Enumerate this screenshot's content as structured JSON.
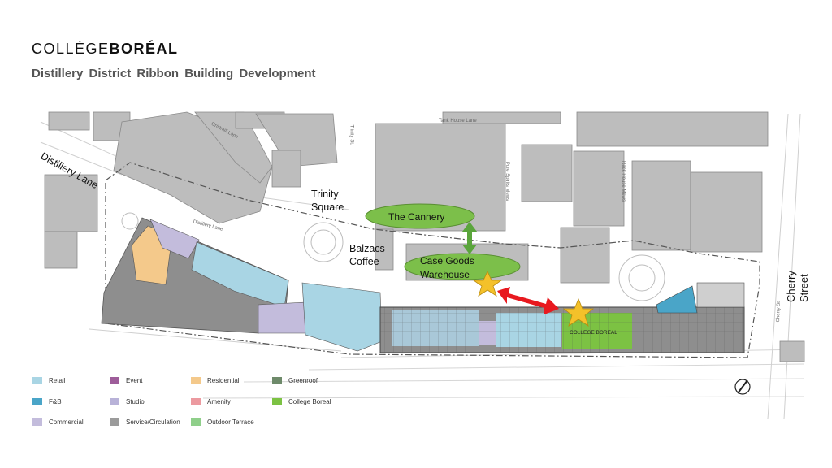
{
  "brand": {
    "part1": "COLLÈGE",
    "part2": "BORÉAL"
  },
  "subtitle": "Distillery District Ribbon Building Development",
  "labels": {
    "distillery_lane": "Distillery Lane",
    "trinity_square": "Trinity Square",
    "balzacs_coffee": "Balzacs Coffee",
    "the_cannery": "The Cannery",
    "case_goods_warehouse": "Case Goods Warehouse",
    "cherry_street": "Cherry Street",
    "college_boreal_plan": "COLLEGE BOREAL",
    "tank_house_lane": "Tank House Lane",
    "gristmill_lane": "Gristmill Lane",
    "trinity_st": "Trinity St.",
    "distillery_lane_small": "Distillery Lane",
    "pure_spirits_mews": "Pure Spirits Mews",
    "rack_house_mews": "Rack House Mews",
    "cherry_st_small": "Cherry St."
  },
  "legend": [
    {
      "label": "Retail",
      "color": "#a9d5e4"
    },
    {
      "label": "Event",
      "color": "#9e5d9a"
    },
    {
      "label": "Residential",
      "color": "#f4c98b"
    },
    {
      "label": "Greenroof",
      "color": "#6e8a6a"
    },
    {
      "label": "F&B",
      "color": "#4aa5c8"
    },
    {
      "label": "Studio",
      "color": "#b8b2d8"
    },
    {
      "label": "Amenity",
      "color": "#ec9aa0"
    },
    {
      "label": "College Boreal",
      "color": "#7cc243"
    },
    {
      "label": "Commercial",
      "color": "#c3bcdc"
    },
    {
      "label": "Service/Circulation",
      "color": "#9b9b9b"
    },
    {
      "label": "Outdoor Terrace",
      "color": "#8fcf8a"
    }
  ],
  "colors": {
    "marker_star": "#f4c12a",
    "marker_ellipse": "#7cbf4a",
    "connector_red": "#e8191f",
    "connector_green": "#5aa53c"
  }
}
